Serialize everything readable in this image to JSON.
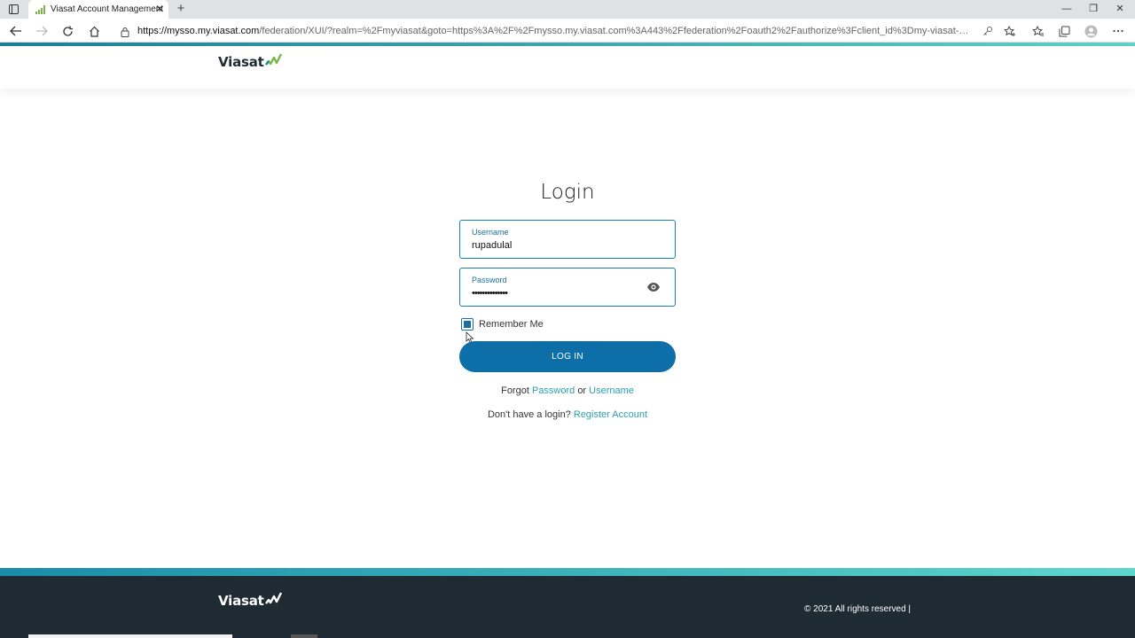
{
  "browser": {
    "tab_title": "Viasat Account Management",
    "tab_close": "✕",
    "new_tab": "+",
    "url_host": "https://mysso.my.viasat.com",
    "url_path": "/federation/XUI/?realm=%2Fmyviasat&goto=https%3A%2F%2Fmysso.my.viasat.com%3A443%2Ffederation%2Foauth2%2Fauthorize%3Fclient_id%3Dmy-viasat-web%26re...",
    "window_controls": {
      "minimize": "—",
      "restore": "❐",
      "close": "✕"
    }
  },
  "header": {
    "logo_text": "Viasat"
  },
  "login": {
    "title": "Login",
    "username_label": "Username",
    "username_value": "rupadulal",
    "password_label": "Password",
    "password_value": "••••••••••••••",
    "remember_label": "Remember Me",
    "remember_checked": true,
    "login_button": "LOG IN",
    "forgot_prefix": "Forgot",
    "forgot_password": "Password",
    "forgot_or": "or",
    "forgot_username": "Username",
    "register_prefix": "Don't have a login?",
    "register_link": "Register Account"
  },
  "footer": {
    "logo_text": "Viasat",
    "copyright": "© 2021 All rights reserved   |"
  },
  "colors": {
    "accent": "#0e6ea8",
    "link": "#2c9fae",
    "logo_green": "#7ab648",
    "footer_bg": "#1f2b33"
  }
}
